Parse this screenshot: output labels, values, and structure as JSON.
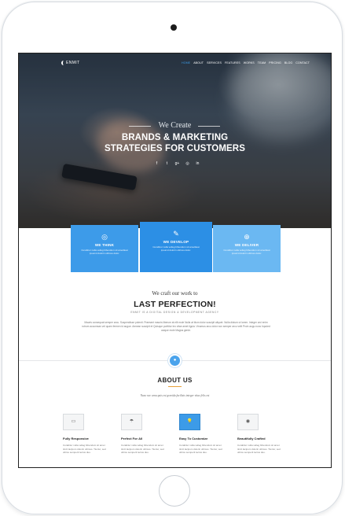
{
  "nav": {
    "logo": "ENMIT",
    "menu": [
      "HOME",
      "ABOUT",
      "SERVICES",
      "FEATURES",
      "WORKS",
      "TEAM",
      "PRICING",
      "BLOG",
      "CONTACT"
    ]
  },
  "hero": {
    "subtitle": "We Create",
    "title_line1": "BRANDS & MARKETING",
    "title_line2": "STRATEGIES FOR CUSTOMERS",
    "socials": [
      "f",
      "t",
      "g+",
      "◎",
      "in"
    ]
  },
  "cards": [
    {
      "icon": "◎",
      "title": "WE THINK",
      "desc": "Curabitur nulla velleg bibendum sit amettleat ipsumd dolorin ultrices dolor."
    },
    {
      "icon": "✎",
      "title": "WE DEVELOP",
      "desc": "Curabitur nulla velleg bibendum sit amettleat ipsumd dolorin ultrices dolor."
    },
    {
      "icon": "⊕",
      "title": "WE DELIVER",
      "desc": "Curabitur nulla velleg bibendum sit amettleat ipsumd dolorin ultrices dolor."
    }
  ],
  "perfection": {
    "kicker": "We craft our work to",
    "title": "LAST PERFECTION!",
    "agency": "ENMIT IS A DIGITAL DESIGN & DEVELOPMENT AGENCY",
    "paragraph": "Mauris consequat semper arcu. Suspendisse potenti. Praesent mauris liberum at elit mole Nulla at blum dolor suscipit aliquet. Nulla dictum ut lorem. Integer orci enim rutrum accumsan vel quam fermen id augue. Aenean suscipit et Quisque porttitor leo vitae amet ligula. Vivamus arcu dolor non semper arcu velit Proin augu nunc Inputed auique mole Magna gente."
  },
  "about": {
    "icon": "●",
    "title": "ABOUT US",
    "tagline": "Nunc nec urna quis est gravida facilisis integer vitae felis est"
  },
  "features": [
    {
      "icon": "▭",
      "title": "Fully Responsive",
      "desc": "Curabitur nulla velleg bibendum sit amet tincit lacipum dolorin ultrices. Tiuntur, sed ultrice semperit lectus duo."
    },
    {
      "icon": "☂",
      "title": "Perfect For All",
      "desc": "Curabitur nulla velleg bibendum sit amet tincit lacipum dolorin ultrices. Tiuntur, sed ultrice semperit lectus duo."
    },
    {
      "icon": "💡",
      "title": "Easy To Customize",
      "desc": "Curabitur nulla velleg bibendum sit amet tincit lacipum dolorin ultrices. Tiuntur, sed ultrice semperit lectus duo."
    },
    {
      "icon": "◉",
      "title": "Beautifully Crafted",
      "desc": "Curabitur nulla velleg bibendum sit amet tincit lacipum dolorin ultrices. Tiuntur, sed ultrice semperit lectus duo."
    }
  ],
  "colors": {
    "accent": "#3c9be8",
    "orange": "#e8a03a"
  }
}
